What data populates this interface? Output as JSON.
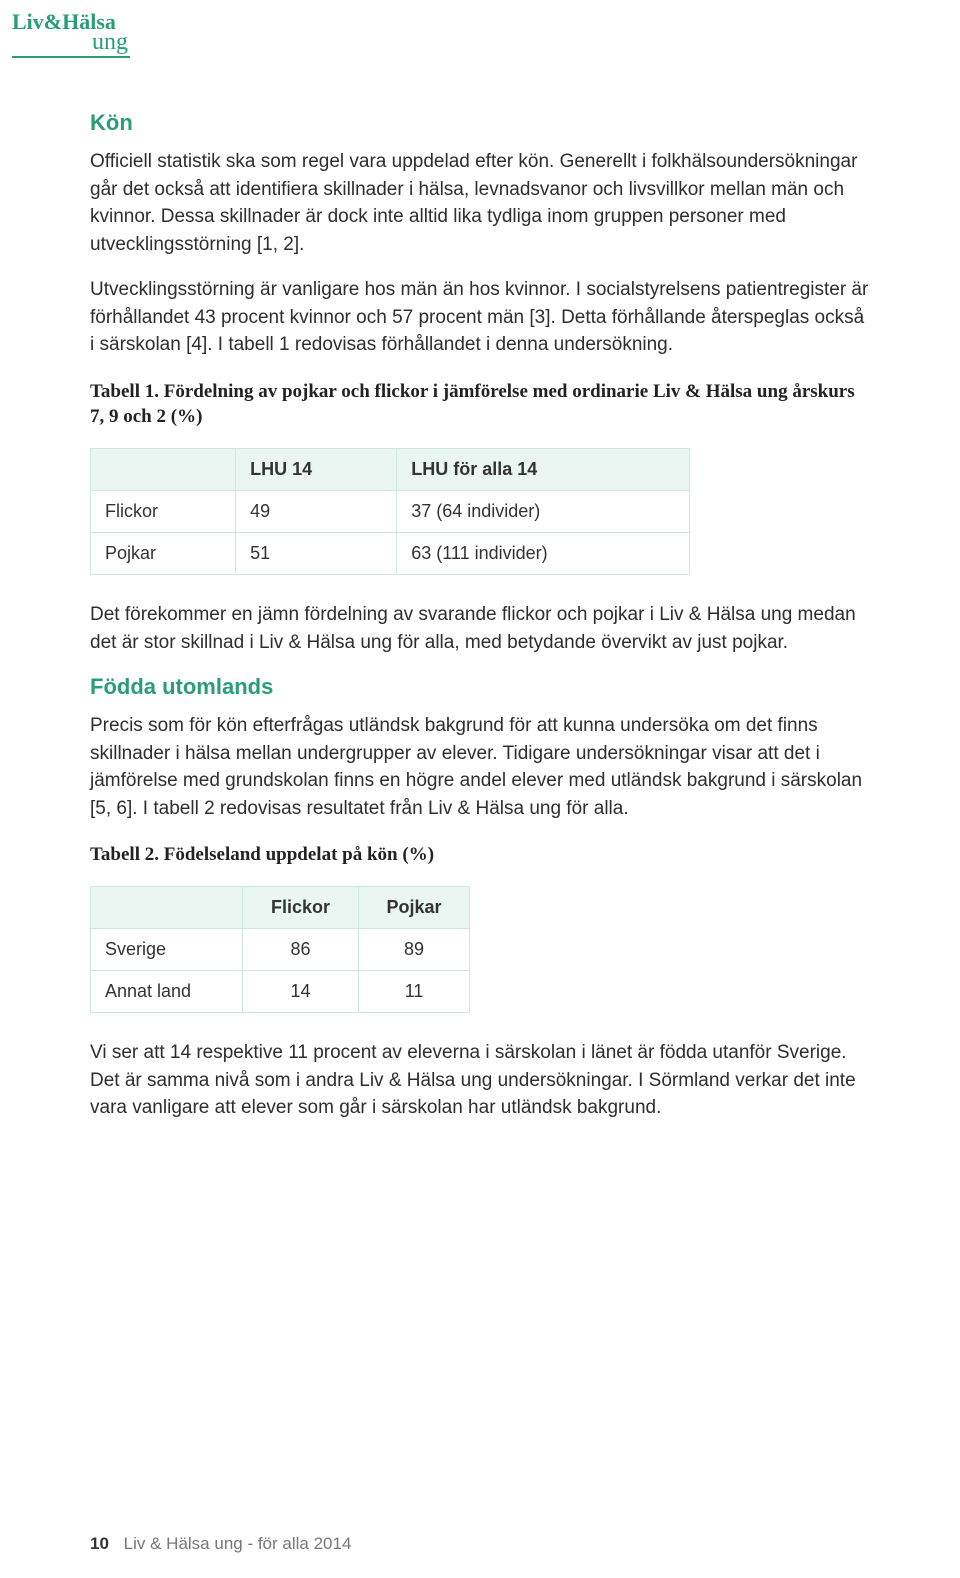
{
  "logo": {
    "main": "Liv&Hälsa",
    "sub": "ung"
  },
  "section1": {
    "heading": "Kön",
    "p1": "Officiell statistik ska som regel vara uppdelad efter kön. Generellt i folkhälsoundersökningar går det också att identifiera skillnader i hälsa, levnadsvanor och livsvillkor mellan män och kvinnor. Dessa skillnader är dock inte alltid lika tydliga inom gruppen personer med utvecklingsstörning [1, 2].",
    "p2": "Utvecklingsstörning är vanligare hos män än hos kvinnor. I socialstyrelsens patientregister är förhållandet 43 procent kvinnor och 57 procent män [3]. Detta förhållande återspeglas också i särskolan [4]. I tabell 1 redovisas förhållandet i denna undersökning."
  },
  "table1": {
    "caption": "Tabell 1. Fördelning av pojkar och flickor i jämförelse med ordinarie Liv & Hälsa ung årskurs 7, 9 och 2 (%)",
    "head": {
      "blank": "",
      "c1": "LHU 14",
      "c2": "LHU för alla 14"
    },
    "rows": [
      {
        "label": "Flickor",
        "c1": "49",
        "c2": "37 (64 individer)"
      },
      {
        "label": "Pojkar",
        "c1": "51",
        "c2": "63 (111 individer)"
      }
    ]
  },
  "mid_para": "Det förekommer en jämn fördelning av svarande flickor och pojkar i Liv & Hälsa ung medan det är stor skillnad i Liv & Hälsa ung för alla, med betydande övervikt av just pojkar.",
  "section2": {
    "heading": "Födda utomlands",
    "p1": "Precis som för kön efterfrågas utländsk bakgrund för att kunna undersöka om det finns skillnader i hälsa mellan undergrupper av elever. Tidigare undersökningar visar att det i jämförelse med grundskolan finns en högre andel elever med utländsk bakgrund i särskolan [5, 6]. I tabell 2 redovisas resultatet från Liv & Hälsa ung för alla."
  },
  "table2": {
    "caption": "Tabell 2. Födelseland uppdelat på kön (%)",
    "head": {
      "blank": "",
      "c1": "Flickor",
      "c2": "Pojkar"
    },
    "rows": [
      {
        "label": "Sverige",
        "c1": "86",
        "c2": "89"
      },
      {
        "label": "Annat land",
        "c1": "14",
        "c2": "11"
      }
    ]
  },
  "end_para": "Vi ser att 14 respektive 11 procent av eleverna i särskolan i länet är födda utanför Sverige. Det är samma nivå som i andra Liv & Hälsa ung undersökningar. I Sörmland verkar det inte vara vanligare att elever som går i särskolan har utländsk bakgrund.",
  "footer": {
    "page": "10",
    "text": "Liv & Hälsa ung -  för alla 2014"
  }
}
